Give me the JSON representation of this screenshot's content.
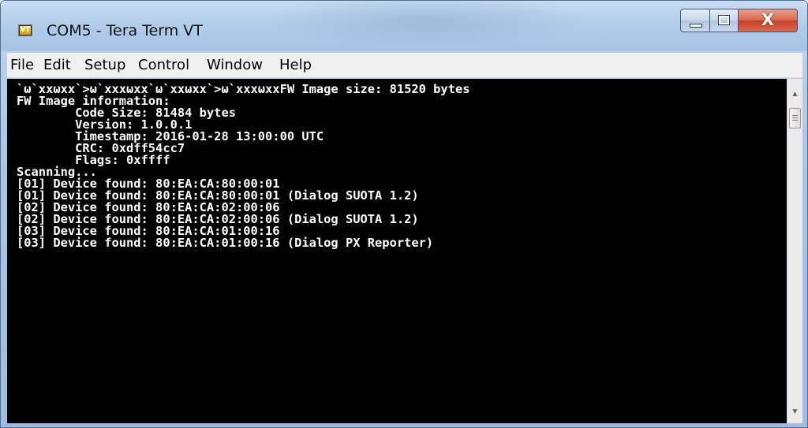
{
  "window": {
    "title": "COM5 - Tera Term VT",
    "icon_label": "VT",
    "controls": {
      "minimize": "minimize-icon",
      "maximize": "maximize-icon",
      "close_glyph": "X"
    }
  },
  "menubar": {
    "items": [
      "File",
      "Edit",
      "Setup",
      "Control",
      "Window",
      "Help"
    ]
  },
  "terminal": {
    "lines": [
      "`ω`xxωxx`>ω`xxxωxx`ω`xxωxx`>ω`xxxωxxFW Image size: 81520 bytes",
      "FW Image information:",
      "        Code Size: 81484 bytes",
      "        Version: 1.0.0.1",
      "        Timestamp: 2016-01-28 13:00:00 UTC",
      "        CRC: 0xdff54cc7",
      "        Flags: 0xffff",
      "Scanning...",
      "[01] Device found: 80:EA:CA:80:00:01",
      "[01] Device found: 80:EA:CA:80:00:01 (Dialog SUOTA 1.2)",
      "[02] Device found: 80:EA:CA:02:00:06",
      "[02] Device found: 80:EA:CA:02:00:06 (Dialog SUOTA 1.2)",
      "[03] Device found: 80:EA:CA:01:00:16",
      "[03] Device found: 80:EA:CA:01:00:16 (Dialog PX Reporter)"
    ]
  },
  "scrollbar": {
    "up": "▲",
    "down": "▼"
  }
}
